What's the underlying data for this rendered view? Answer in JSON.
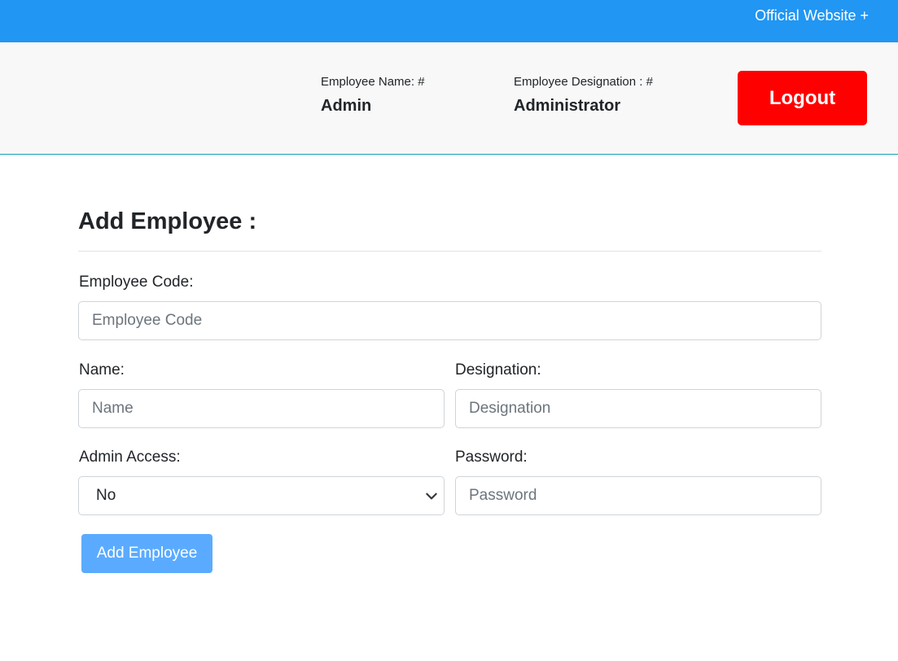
{
  "topbar": {
    "link_label": "Official Website +"
  },
  "header": {
    "employee_name_label": "Employee Name: #",
    "employee_name_value": "Admin",
    "employee_designation_label": "Employee Designation : #",
    "employee_designation_value": "Administrator",
    "logout_label": "Logout"
  },
  "form": {
    "title": "Add Employee :",
    "employee_code": {
      "label": "Employee Code:",
      "placeholder": "Employee Code",
      "value": ""
    },
    "name": {
      "label": "Name:",
      "placeholder": "Name",
      "value": ""
    },
    "designation": {
      "label": "Designation:",
      "placeholder": "Designation",
      "value": ""
    },
    "admin_access": {
      "label": "Admin Access:",
      "selected": "No"
    },
    "password": {
      "label": "Password:",
      "placeholder": "Password",
      "value": ""
    },
    "submit_label": "Add Employee"
  },
  "colors": {
    "topbar": "#2196f3",
    "logout": "#ff0000",
    "submit": "#5aabff"
  }
}
